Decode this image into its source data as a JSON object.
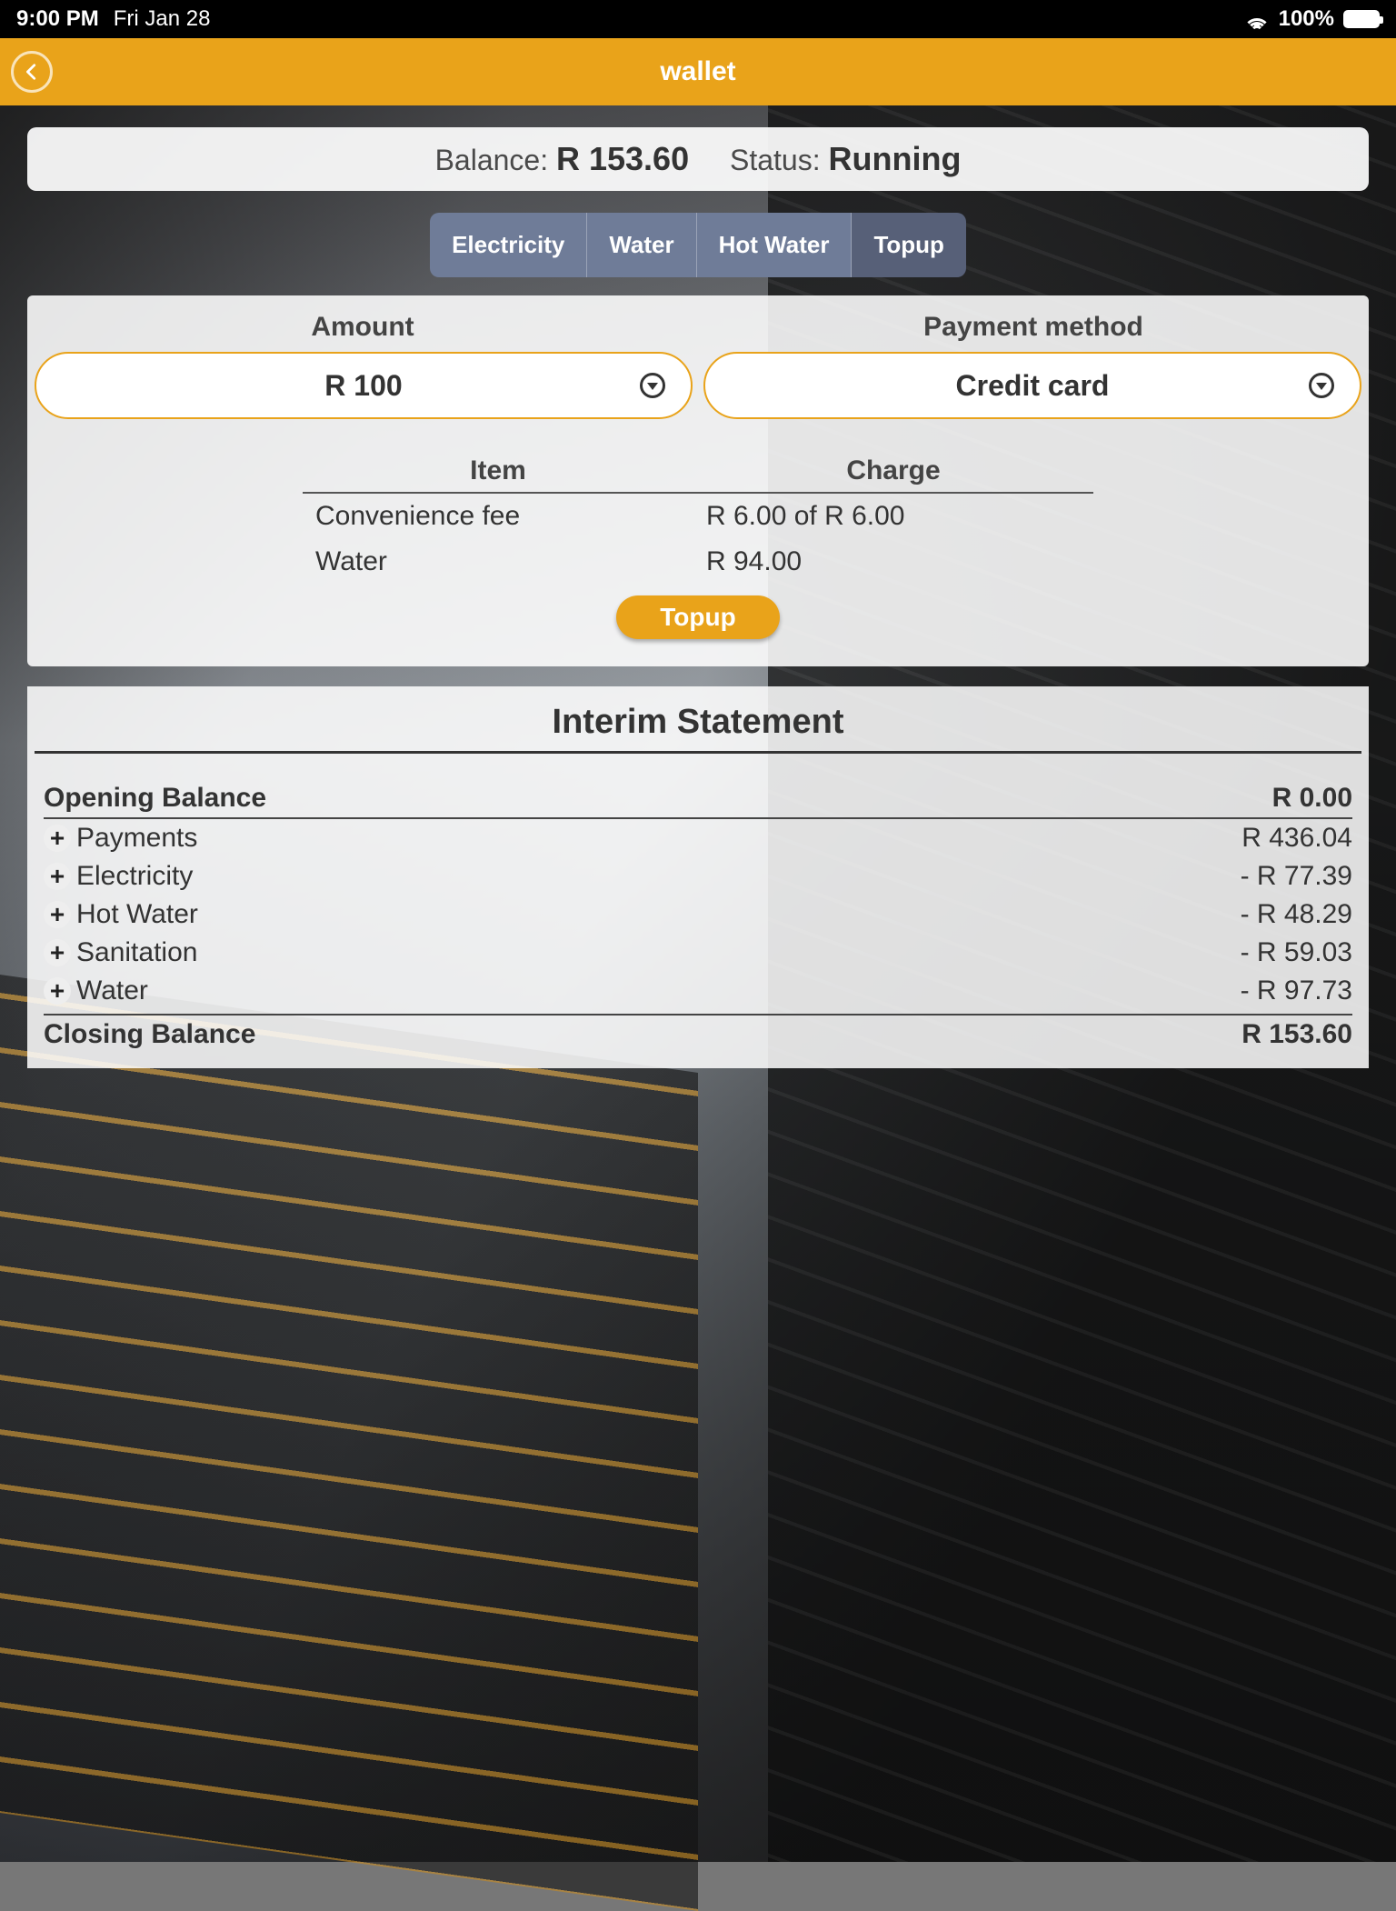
{
  "status_bar": {
    "time": "9:00 PM",
    "date": "Fri Jan 28",
    "battery_pct": "100%"
  },
  "nav": {
    "title": "wallet"
  },
  "balance_card": {
    "balance_label": "Balance: ",
    "balance_value": "R 153.60",
    "status_label": "Status: ",
    "status_value": "Running"
  },
  "tabs": [
    {
      "label": "Electricity",
      "active": false
    },
    {
      "label": "Water",
      "active": false
    },
    {
      "label": "Hot Water",
      "active": false
    },
    {
      "label": "Topup",
      "active": true
    }
  ],
  "topup": {
    "amount_label": "Amount",
    "payment_label": "Payment method",
    "amount_value": "R 100",
    "payment_value": "Credit card",
    "item_header": "Item",
    "charge_header": "Charge",
    "rows": [
      {
        "item": "Convenience fee",
        "charge": "R 6.00 of R 6.00"
      },
      {
        "item": "Water",
        "charge": "R 94.00"
      }
    ],
    "button": "Topup"
  },
  "statement": {
    "title": "Interim Statement",
    "opening_label": "Opening Balance",
    "opening_value": "R 0.00",
    "items": [
      {
        "label": "Payments",
        "value": "R 436.04"
      },
      {
        "label": "Electricity",
        "value": "- R 77.39"
      },
      {
        "label": "Hot Water",
        "value": "- R 48.29"
      },
      {
        "label": "Sanitation",
        "value": "- R 59.03"
      },
      {
        "label": "Water",
        "value": "- R 97.73"
      }
    ],
    "closing_label": "Closing Balance",
    "closing_value": "R 153.60"
  }
}
